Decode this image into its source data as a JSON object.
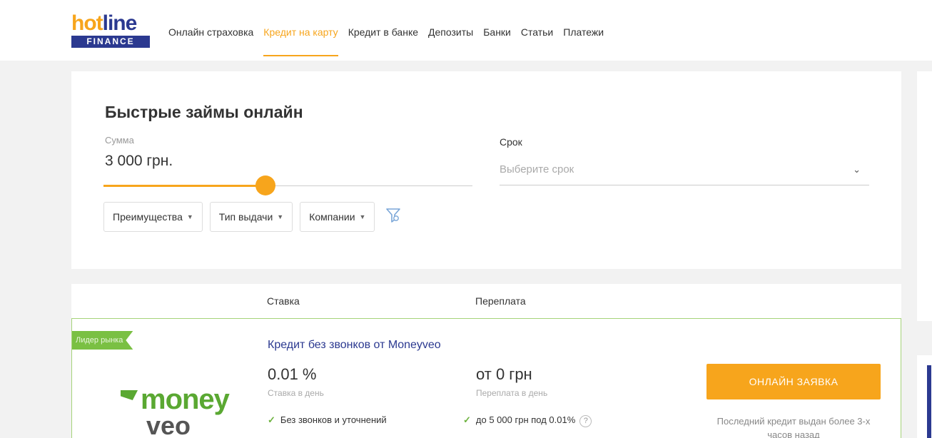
{
  "header": {
    "logo": {
      "top": "hotline",
      "bottom": "FINANCE"
    },
    "nav": [
      {
        "label": "Онлайн страховка"
      },
      {
        "label": "Кредит на карту",
        "active": true
      },
      {
        "label": "Кредит в банке"
      },
      {
        "label": "Депозиты"
      },
      {
        "label": "Банки"
      },
      {
        "label": "Статьи"
      },
      {
        "label": "Платежи"
      }
    ]
  },
  "filter": {
    "title": "Быстрые займы онлайн",
    "sum_label": "Сумма",
    "sum_value": "3 000 грн.",
    "slider_fraction": 0.44,
    "term_label": "Срок",
    "term_placeholder": "Выберите срок",
    "chips": [
      {
        "label": "Преимущества"
      },
      {
        "label": "Тип выдачи"
      },
      {
        "label": "Компании"
      }
    ],
    "filter_icon": "funnel-icon"
  },
  "results": {
    "columns": {
      "rate": "Ставка",
      "overpay": "Переплата"
    },
    "offer": {
      "badge": "Лидер рынка",
      "logo": {
        "line1": "money",
        "line2": "veo"
      },
      "title": "Кредит без звонков от Moneyveo",
      "rate_value": "0.01 %",
      "rate_label": "Ставка в день",
      "overpay_value": "от 0 грн",
      "overpay_label": "Переплата в день",
      "features": [
        "Без звонков и уточнений",
        "до 5 000 грн под 0.01%"
      ],
      "help": "?",
      "apply_label": "ОНЛАЙН ЗАЯВКА",
      "last_issued": "Последний кредит выдан более 3-х часов назад"
    }
  },
  "colors": {
    "accent": "#f7a51c",
    "brand": "#2b3990",
    "leader_green": "#7ac043"
  }
}
